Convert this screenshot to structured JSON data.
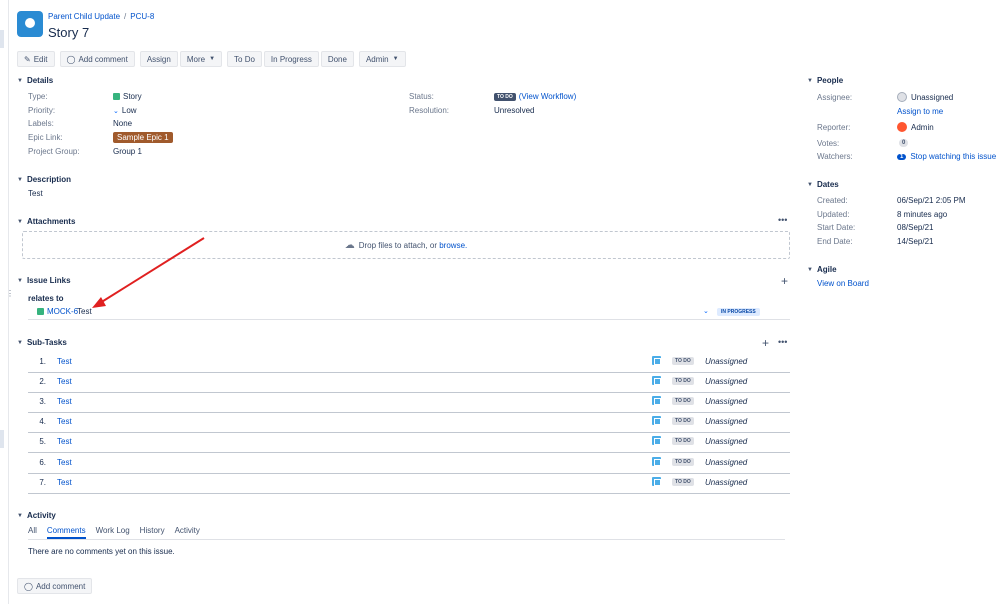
{
  "breadcrumb": {
    "project": "Parent Child Update",
    "issue_key": "PCU-8"
  },
  "issue": {
    "title": "Story 7"
  },
  "toolbar": {
    "edit": "Edit",
    "add_comment": "Add comment",
    "assign": "Assign",
    "more": "More",
    "todo": "To Do",
    "in_progress": "In Progress",
    "done": "Done",
    "admin": "Admin"
  },
  "details": {
    "heading": "Details",
    "type_label": "Type:",
    "type_value": "Story",
    "priority_label": "Priority:",
    "priority_value": "Low",
    "labels_label": "Labels:",
    "labels_value": "None",
    "epic_label": "Epic Link:",
    "epic_value": "Sample Epic 1",
    "project_group_label": "Project Group:",
    "project_group_value": "Group 1",
    "status_label": "Status:",
    "status_value": "TO DO",
    "view_workflow": "(View Workflow)",
    "resolution_label": "Resolution:",
    "resolution_value": "Unresolved"
  },
  "description": {
    "heading": "Description",
    "text": "Test"
  },
  "attachments": {
    "heading": "Attachments",
    "drop_text": "Drop files to attach, or",
    "browse": "browse."
  },
  "issue_links": {
    "heading": "Issue Links",
    "relation": "relates to",
    "linked_key": "MOCK-6",
    "linked_summary": "Test",
    "linked_status": "IN PROGRESS"
  },
  "subtasks": {
    "heading": "Sub-Tasks",
    "items": [
      {
        "num": "1.",
        "name": "Test",
        "status": "TO DO",
        "assignee": "Unassigned"
      },
      {
        "num": "2.",
        "name": "Test",
        "status": "TO DO",
        "assignee": "Unassigned"
      },
      {
        "num": "3.",
        "name": "Test",
        "status": "TO DO",
        "assignee": "Unassigned"
      },
      {
        "num": "4.",
        "name": "Test",
        "status": "TO DO",
        "assignee": "Unassigned"
      },
      {
        "num": "5.",
        "name": "Test",
        "status": "TO DO",
        "assignee": "Unassigned"
      },
      {
        "num": "6.",
        "name": "Test",
        "status": "TO DO",
        "assignee": "Unassigned"
      },
      {
        "num": "7.",
        "name": "Test",
        "status": "TO DO",
        "assignee": "Unassigned"
      }
    ]
  },
  "activity": {
    "heading": "Activity",
    "tabs": [
      "All",
      "Comments",
      "Work Log",
      "History",
      "Activity"
    ],
    "empty_text": "There are no comments yet on this issue.",
    "add_comment": "Add comment"
  },
  "people": {
    "heading": "People",
    "assignee_label": "Assignee:",
    "assignee_value": "Unassigned",
    "assign_to_me": "Assign to me",
    "reporter_label": "Reporter:",
    "reporter_value": "Admin",
    "votes_label": "Votes:",
    "votes_value": "0",
    "watchers_label": "Watchers:",
    "watchers_count": "1",
    "stop_watching": "Stop watching this issue"
  },
  "dates": {
    "heading": "Dates",
    "created_label": "Created:",
    "created_value": "06/Sep/21 2:05 PM",
    "updated_label": "Updated:",
    "updated_value": "8 minutes ago",
    "start_label": "Start Date:",
    "start_value": "08/Sep/21",
    "end_label": "End Date:",
    "end_value": "14/Sep/21"
  },
  "agile": {
    "heading": "Agile",
    "view_on_board": "View on Board"
  },
  "colors": {
    "link": "#0052cc",
    "arrow": "#e02020",
    "epic": "#a05a2c",
    "todo": "#42526e"
  }
}
